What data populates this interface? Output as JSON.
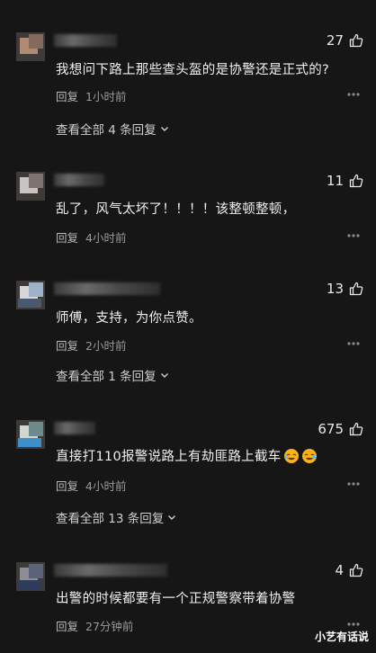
{
  "comments": [
    {
      "likes": "27",
      "text": "我想问下路上那些查头盔的是协警还是正式的?",
      "reply_label": "回复",
      "time": "1小时前",
      "view_replies": "查看全部 4 条回复"
    },
    {
      "likes": "11",
      "text": "乱了，风气太坏了！！！！该整顿整顿，",
      "reply_label": "回复",
      "time": "4小时前"
    },
    {
      "likes": "13",
      "text": "师傅，支持，为你点赞。",
      "reply_label": "回复",
      "time": "2小时前",
      "view_replies": "查看全部 1 条回复"
    },
    {
      "likes": "675",
      "text": "直接打110报警说路上有劫匪路上截车",
      "reply_label": "回复",
      "time": "4小时前",
      "view_replies": "查看全部 13 条回复"
    },
    {
      "likes": "4",
      "text": "出警的时候都要有一个正规警察带着协警",
      "reply_label": "回复",
      "time": "27分钟前"
    }
  ],
  "watermark": "小艺有话说",
  "icons": {
    "like": "thumb-up-icon",
    "more": "more-dots-icon",
    "expand": "chevron-down-icon",
    "emoji": "laughing-emoji-icon"
  }
}
